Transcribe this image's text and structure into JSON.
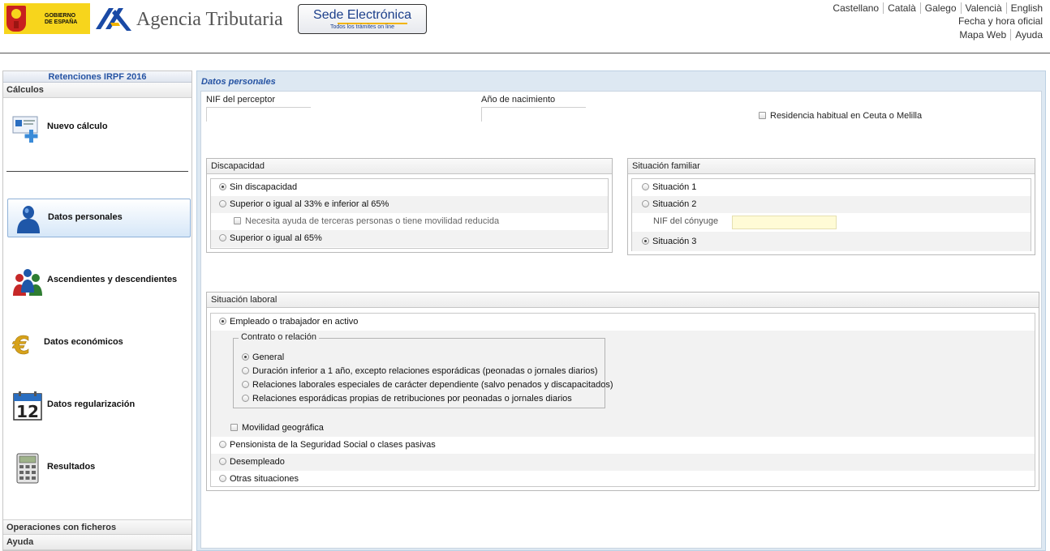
{
  "header": {
    "gob_line1": "GOBIERNO",
    "gob_line2": "DE ESPAÑA",
    "agency_title": "Agencia Tributaria",
    "sede_title": "Sede Electrónica",
    "sede_subtitle": "Todos los trámites on line",
    "languages": [
      "Castellano",
      "Català",
      "Galego",
      "Valencià",
      "English"
    ],
    "fecha_hora": "Fecha y hora oficial",
    "mapa_web": "Mapa Web",
    "ayuda": "Ayuda"
  },
  "sidebar": {
    "title": "Retenciones IRPF 2016",
    "section_calculos": "Cálculos",
    "nuevo_calculo": "Nuevo cálculo",
    "items": [
      {
        "label": "Datos personales",
        "icon": "person-icon"
      },
      {
        "label": "Ascendientes y descendientes",
        "icon": "family-icon"
      },
      {
        "label": "Datos económicos",
        "icon": "euro-icon"
      },
      {
        "label": "Datos regularización",
        "icon": "calendar-icon"
      },
      {
        "label": "Resultados",
        "icon": "calculator-icon"
      }
    ],
    "section_ficheros": "Operaciones con ficheros",
    "section_ayuda": "Ayuda"
  },
  "main": {
    "title": "Datos personales",
    "nif_perceptor_label": "NIF del perceptor",
    "nif_perceptor_value": "",
    "anio_nacimiento_label": "Año de nacimiento",
    "anio_nacimiento_value": "",
    "residencia_label": "Residencia habitual en Ceuta o Melilla",
    "discapacidad": {
      "title": "Discapacidad",
      "options": [
        "Sin discapacidad",
        "Superior o igual al 33% e inferior al 65%",
        "Superior o igual al 65%"
      ],
      "ayuda_check": "Necesita ayuda de terceras personas o tiene movilidad reducida",
      "selected": "Sin discapacidad"
    },
    "situacion_familiar": {
      "title": "Situación familiar",
      "options": [
        "Situación 1",
        "Situación 2",
        "Situación 3"
      ],
      "nif_conyuge_label": "NIF del cónyuge",
      "nif_conyuge_value": "",
      "selected": "Situación 3"
    },
    "situacion_laboral": {
      "title": "Situación laboral",
      "empleado": "Empleado o trabajador en activo",
      "contrato_legend": "Contrato o relación",
      "contrato_options": [
        "General",
        "Duración inferior a 1 año, excepto relaciones esporádicas (peonadas o jornales diarios)",
        "Relaciones laborales especiales de carácter dependiente (salvo penados y discapacitados)",
        "Relaciones esporádicas propias de retribuciones por peonadas o jornales diarios"
      ],
      "movilidad": "Movilidad geográfica",
      "pensionista": "Pensionista de la Seguridad Social o clases pasivas",
      "desempleado": "Desempleado",
      "otras": "Otras situaciones",
      "selected": "Empleado o trabajador en activo",
      "contrato_selected": "General"
    }
  },
  "colors": {
    "accent_blue": "#2553a3",
    "panel_bg": "#dde8f2",
    "nif_conyuge_bg": "#fffbd6"
  }
}
